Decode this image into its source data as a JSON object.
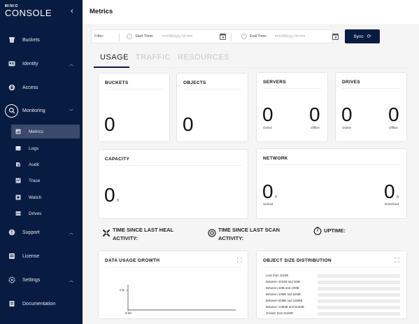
{
  "brand": {
    "top": "MINIO",
    "bottom": "CONSOLE"
  },
  "sidebar": {
    "collapse_icon": "chevron-left-icon",
    "items": [
      {
        "label": "Buckets",
        "icon": "bucket-icon"
      },
      {
        "label": "Identity",
        "icon": "id-card-icon",
        "chevron": "up"
      },
      {
        "label": "Access",
        "icon": "lock-icon"
      },
      {
        "label": "Monitoring",
        "icon": "search-icon",
        "chevron": "down"
      },
      {
        "label": "Support",
        "icon": "support-icon",
        "chevron": "up"
      },
      {
        "label": "License",
        "icon": "license-icon"
      },
      {
        "label": "Settings",
        "icon": "gear-icon",
        "chevron": "up"
      },
      {
        "label": "Documentation",
        "icon": "document-icon"
      }
    ],
    "sub_items": [
      {
        "label": "Metrics",
        "icon": "metrics-icon",
        "active": true
      },
      {
        "label": "Logs",
        "icon": "logs-icon"
      },
      {
        "label": "Audit",
        "icon": "audit-icon"
      },
      {
        "label": "Trace",
        "icon": "trace-icon"
      },
      {
        "label": "Watch",
        "icon": "watch-icon"
      },
      {
        "label": "Drives",
        "icon": "drives-icon"
      }
    ]
  },
  "header": {
    "title": "Metrics"
  },
  "filter": {
    "label": "Filter:",
    "start_label": "Start Time:",
    "start_placeholder": "mm/dd/yyyy hh:mm",
    "end_label": "End Time:",
    "end_placeholder": "mm/dd/yyyy hh:mm"
  },
  "sync_button": {
    "label": "Sync",
    "icon": "refresh-icon"
  },
  "tabs": [
    {
      "label": "USAGE",
      "active": true
    },
    {
      "label": "TRAFFIC",
      "active": false
    },
    {
      "label": "RESOURCES",
      "active": false
    }
  ],
  "cards": {
    "buckets": {
      "title": "BUCKETS",
      "value": "0"
    },
    "objects": {
      "title": "OBJECTS",
      "value": "0"
    },
    "servers": {
      "title": "SERVERS",
      "online_value": "0",
      "online_label": "Online",
      "offline_value": "0",
      "offline_label": "Offline"
    },
    "drives": {
      "title": "DRIVES",
      "online_value": "0",
      "online_label": "Online",
      "offline_value": "0",
      "offline_label": "Offline"
    },
    "capacity": {
      "title": "CAPACITY",
      "value": "0",
      "unit": "B"
    },
    "network": {
      "title": "NETWORK",
      "upload_value": "0",
      "upload_unit": "B",
      "upload_label": "Upload",
      "download_value": "0",
      "download_unit": "B",
      "download_label": "Download"
    }
  },
  "time_info": {
    "heal": {
      "line1": "TIME SINCE LAST HEAL",
      "line2": "ACTIVITY:"
    },
    "scan": {
      "line1": "TIME SINCE LAST SCAN",
      "line2": "ACTIVITY:"
    },
    "uptime": {
      "label": "UPTIME:"
    }
  },
  "data_usage": {
    "title": "DATA USAGE GROWTH",
    "chart_data": {
      "type": "line",
      "x": [
        "9:00"
      ],
      "y": [
        0
      ],
      "y_tick": "0 B",
      "x_tick": "9:00"
    }
  },
  "object_dist": {
    "title": "OBJECT SIZE DISTRIBUTION",
    "rows": [
      {
        "label": "Less than 1024B",
        "value": 0
      },
      {
        "label": "Between 1024B and 1MB",
        "value": 0
      },
      {
        "label": "Between 1MB and 10MB",
        "value": 0
      },
      {
        "label": "Between 10MB and 64MB",
        "value": 0
      },
      {
        "label": "Between 64MB and 128MB",
        "value": 0
      },
      {
        "label": "Between 128MB and 512MB",
        "value": 0
      },
      {
        "label": "Greater than 512MB",
        "value": 0
      }
    ]
  }
}
